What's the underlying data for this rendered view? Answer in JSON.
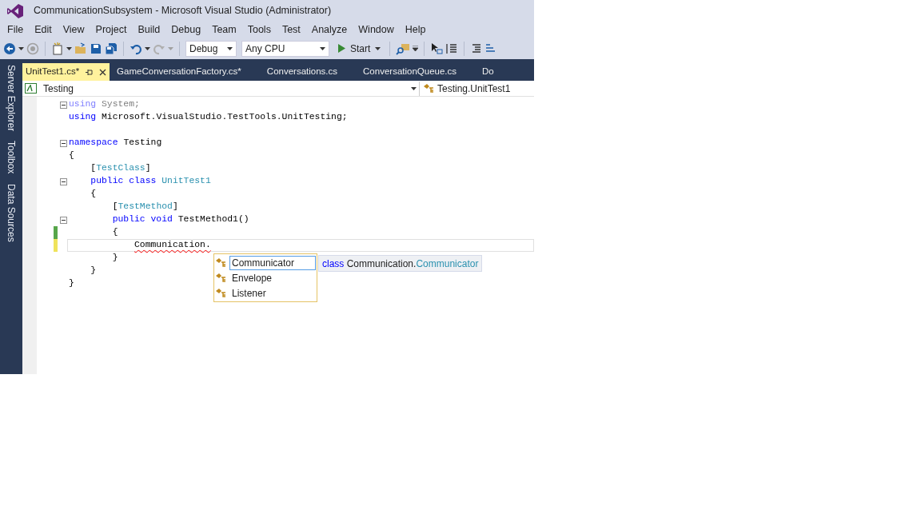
{
  "window": {
    "title": "CommunicationSubsystem - Microsoft Visual Studio (Administrator)"
  },
  "menu": [
    "File",
    "Edit",
    "View",
    "Project",
    "Build",
    "Debug",
    "Team",
    "Tools",
    "Test",
    "Analyze",
    "Window",
    "Help"
  ],
  "toolbar": {
    "configuration": "Debug",
    "platform": "Any CPU",
    "start": "Start"
  },
  "side_tabs": [
    "Server Explorer",
    "Toolbox",
    "Data Sources"
  ],
  "tabs": [
    {
      "label": "UnitTest1.cs*",
      "selected": true
    },
    {
      "label": "GameConversationFactory.cs*",
      "selected": false
    },
    {
      "label": "Conversations.cs",
      "selected": false
    },
    {
      "label": "ConversationQueue.cs",
      "selected": false
    },
    {
      "label": "Do",
      "selected": false
    }
  ],
  "nav_bar": {
    "project": "Testing",
    "type": "Testing.UnitTest1"
  },
  "code_lines": [
    {
      "kind": "code",
      "tokens": [
        {
          "text": "using",
          "kind": "dim_keyword"
        },
        {
          "text": " System;",
          "kind": "dim"
        }
      ],
      "fold": true
    },
    {
      "kind": "code",
      "tokens": [
        {
          "text": "using",
          "kind": "keyword"
        },
        {
          "text": " Microsoft.VisualStudio.TestTools.UnitTesting;",
          "kind": "plain"
        }
      ]
    },
    {
      "kind": "blank"
    },
    {
      "kind": "code",
      "tokens": [
        {
          "text": "namespace",
          "kind": "keyword"
        },
        {
          "text": " Testing",
          "kind": "plain"
        }
      ],
      "fold": true
    },
    {
      "kind": "code",
      "tokens": [
        {
          "text": "{",
          "kind": "plain"
        }
      ]
    },
    {
      "kind": "code",
      "tokens": [
        {
          "text": "    [",
          "kind": "plain"
        },
        {
          "text": "TestClass",
          "kind": "type"
        },
        {
          "text": "]",
          "kind": "plain"
        }
      ]
    },
    {
      "kind": "code",
      "tokens": [
        {
          "text": "    public class",
          "kind": "keyword"
        },
        {
          "text": " UnitTest1",
          "kind": "type"
        }
      ],
      "fold": true
    },
    {
      "kind": "code",
      "tokens": [
        {
          "text": "    {",
          "kind": "plain"
        }
      ]
    },
    {
      "kind": "code",
      "tokens": [
        {
          "text": "        [",
          "kind": "plain"
        },
        {
          "text": "TestMethod",
          "kind": "type"
        },
        {
          "text": "]",
          "kind": "plain"
        }
      ]
    },
    {
      "kind": "code",
      "tokens": [
        {
          "text": "        public void",
          "kind": "keyword"
        },
        {
          "text": " TestMethod1()",
          "kind": "plain"
        }
      ],
      "fold": true
    },
    {
      "kind": "code",
      "tokens": [
        {
          "text": "        {",
          "kind": "plain"
        }
      ],
      "color": "#57a64a"
    },
    {
      "kind": "code",
      "tokens": [
        {
          "text": "            Communication.",
          "kind": "error"
        }
      ],
      "color": "#efe35b",
      "current": true
    },
    {
      "kind": "code",
      "tokens": [
        {
          "text": "        }",
          "kind": "plain"
        }
      ]
    },
    {
      "kind": "code",
      "tokens": [
        {
          "text": "    }",
          "kind": "plain"
        }
      ]
    },
    {
      "kind": "code",
      "tokens": [
        {
          "text": "}",
          "kind": "plain"
        }
      ]
    }
  ],
  "completion": {
    "items": [
      {
        "label": "Communicator",
        "selected": true
      },
      {
        "label": "Envelope",
        "selected": false
      },
      {
        "label": "Listener",
        "selected": false
      }
    ],
    "tooltip": [
      {
        "text": "class",
        "kind": "keyword"
      },
      {
        "text": " Communication.",
        "kind": "plain"
      },
      {
        "text": "Communicator",
        "kind": "type"
      }
    ]
  }
}
